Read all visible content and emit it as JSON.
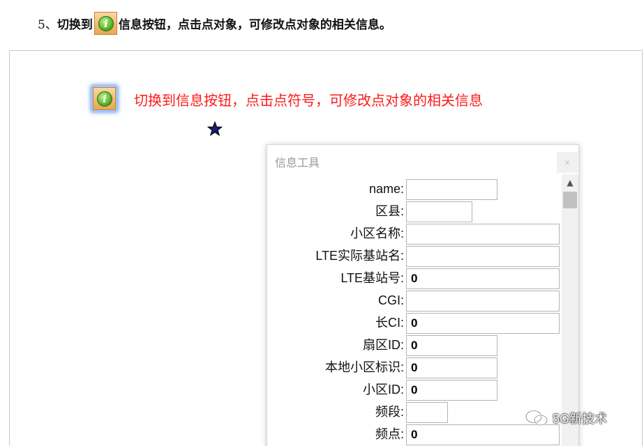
{
  "instruction": {
    "number": "5、",
    "before": "切换到",
    "after": "信息按钮，点击点对象，可修改点对象的相关信息。",
    "icon": "info-icon"
  },
  "canvas": {
    "caption": "切换到信息按钮，点击点符号，可修改点对象的相关信息",
    "caption_color": "#ff1a1a",
    "marker": "star-icon"
  },
  "dialog": {
    "title": "信息工具",
    "close": "×",
    "fields": [
      {
        "label": "name:",
        "value": ""
      },
      {
        "label": "区县:",
        "value": ""
      },
      {
        "label": "小区名称:",
        "value": ""
      },
      {
        "label": "LTE实际基站名:",
        "value": ""
      },
      {
        "label": "LTE基站号:",
        "value": "0"
      },
      {
        "label": "CGI:",
        "value": ""
      },
      {
        "label": "长CI:",
        "value": "0"
      },
      {
        "label": "扇区ID:",
        "value": "0"
      },
      {
        "label": "本地小区标识:",
        "value": "0"
      },
      {
        "label": "小区ID:",
        "value": "0"
      },
      {
        "label": "频段:",
        "value": ""
      },
      {
        "label": "频点:",
        "value": "0"
      }
    ]
  },
  "watermark": {
    "text": "5G新技术"
  }
}
